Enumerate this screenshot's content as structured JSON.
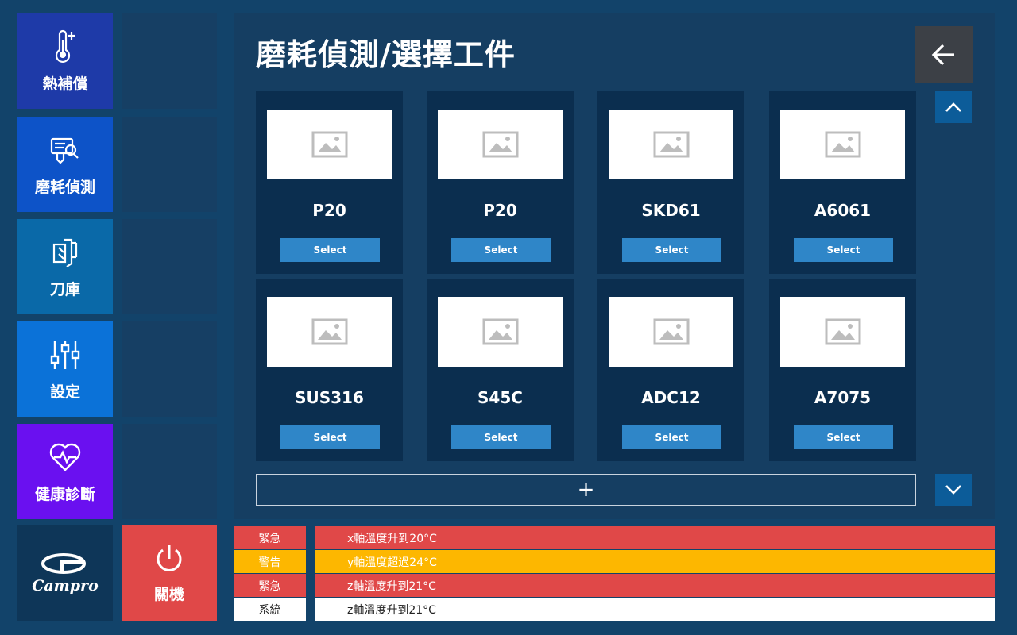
{
  "nav": {
    "items": [
      {
        "label": "熱補償",
        "icon": "thermometer-plus-icon",
        "color": "#1e3aa8"
      },
      {
        "label": "磨耗偵測",
        "icon": "wear-detect-icon",
        "color": "#0d53c8"
      },
      {
        "label": "刀庫",
        "icon": "tool-magazine-icon",
        "color": "#0a69a8"
      },
      {
        "label": "設定",
        "icon": "sliders-icon",
        "color": "#0b72d8"
      },
      {
        "label": "健康診斷",
        "icon": "heartbeat-icon",
        "color": "#6a10f0"
      }
    ]
  },
  "page": {
    "title": "磨耗偵測/選擇工件"
  },
  "workpieces": [
    {
      "name": "P20",
      "button": "Select"
    },
    {
      "name": "P20",
      "button": "Select"
    },
    {
      "name": "SKD61",
      "button": "Select"
    },
    {
      "name": "A6061",
      "button": "Select"
    },
    {
      "name": "SUS316",
      "button": "Select"
    },
    {
      "name": "S45C",
      "button": "Select"
    },
    {
      "name": "ADC12",
      "button": "Select"
    },
    {
      "name": "A7075",
      "button": "Select"
    }
  ],
  "add_label": "+",
  "logo": {
    "text": "Campro"
  },
  "power": {
    "label": "關機"
  },
  "alarms": [
    {
      "level": "緊急",
      "message": "x軸溫度升到20°C",
      "color": "#e04848",
      "text_color": "#ffffff"
    },
    {
      "level": "警告",
      "message": "y軸溫度超過24°C",
      "color": "#fdb700",
      "text_color": "#ffffff"
    },
    {
      "level": "緊急",
      "message": "z軸溫度升到21°C",
      "color": "#e04848",
      "text_color": "#ffffff"
    },
    {
      "level": "系統",
      "message": "z軸溫度升到21°C",
      "color": "#ffffff",
      "text_color": "#222222"
    }
  ]
}
